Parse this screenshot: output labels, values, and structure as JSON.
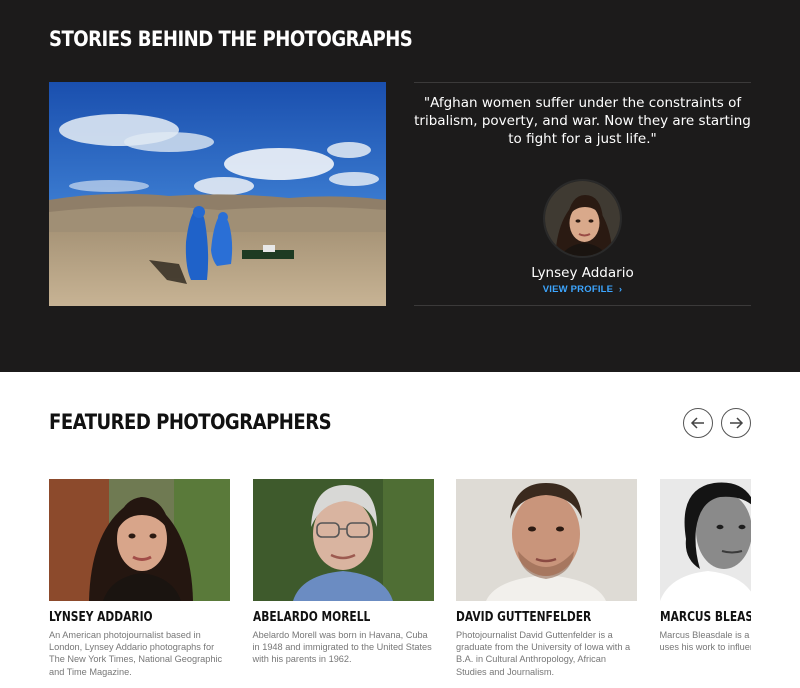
{
  "stories": {
    "title": "STORIES BEHIND THE PHOTOGRAPHS",
    "quote": "\"Afghan women suffer under the constraints of tribalism, poverty, and war. Now they are starting to fight for a just life.\"",
    "photographer_name": "Lynsey Addario",
    "profile_link": "VIEW PROFILE",
    "profile_link_icon": "chevron-right-icon"
  },
  "featured": {
    "title": "FEATURED PHOTOGRAPHERS",
    "prev_icon": "arrow-left-icon",
    "next_icon": "arrow-right-icon",
    "photographers": [
      {
        "name": "LYNSEY ADDARIO",
        "bio": "An American photojournalist based in London, Lynsey Addario photographs for The New York Times, National Geographic and Time Magazine."
      },
      {
        "name": "ABELARDO MORELL",
        "bio": "Abelardo Morell was born in Havana, Cuba in 1948 and immigrated to the United States with his parents in 1962."
      },
      {
        "name": "DAVID GUTTENFELDER",
        "bio": "Photojournalist David Guttenfelder is a graduate from the University of Iowa with a B.A. in Cultural Anthropology, African Studies and Journalism."
      },
      {
        "name": "MARCUS BLEASDALE",
        "bio": "Marcus Bleasdale is a photojournalist who uses his work to influence policy makers"
      }
    ]
  },
  "colors": {
    "dark_bg": "#1c1b1b",
    "link_blue": "#3da6ff",
    "burqa_blue": "#1f62c9"
  }
}
